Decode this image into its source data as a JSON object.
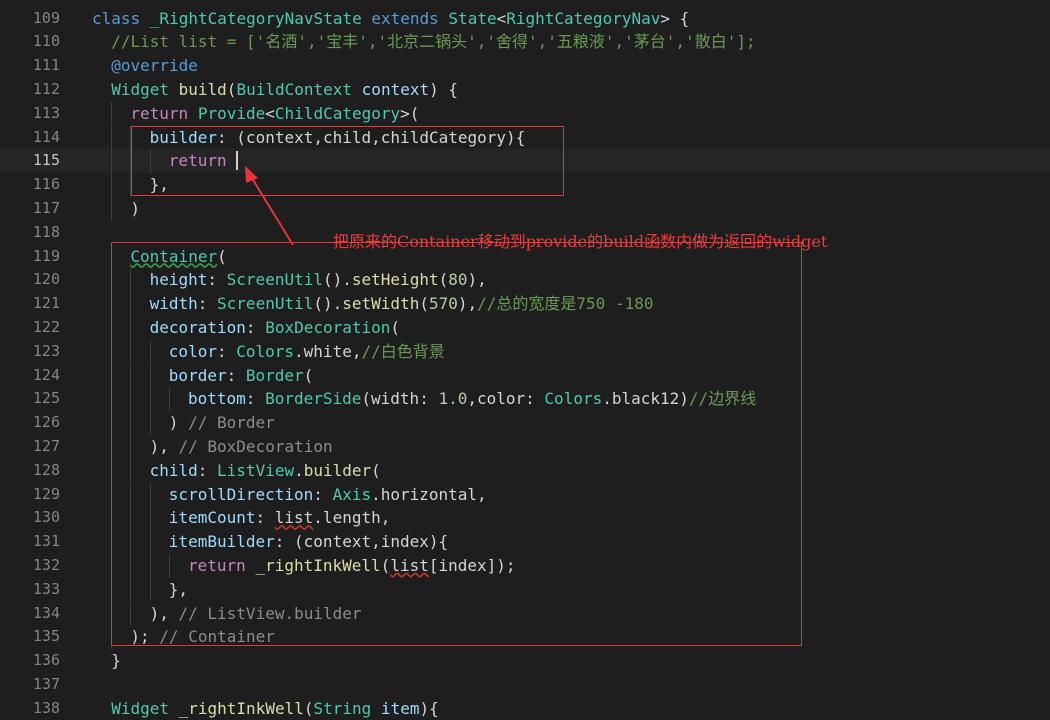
{
  "editor": {
    "lines": [
      {
        "n": "109",
        "indent": 0,
        "tokens": [
          [
            "kw",
            "class "
          ],
          [
            "cls",
            "_RightCategoryNavState "
          ],
          [
            "kw",
            "extends "
          ],
          [
            "cls",
            "State"
          ],
          [
            "pl",
            "<"
          ],
          [
            "cls",
            "RightCategoryNav"
          ],
          [
            "pl",
            "> {"
          ]
        ]
      },
      {
        "n": "110",
        "indent": 1,
        "tokens": [
          [
            "cmt",
            "//List list = ['名酒','宝丰','北京二锅头','舍得','五粮液','茅台','散白'];"
          ]
        ]
      },
      {
        "n": "111",
        "indent": 1,
        "tokens": [
          [
            "kw",
            "@override"
          ]
        ]
      },
      {
        "n": "112",
        "indent": 1,
        "tokens": [
          [
            "cls",
            "Widget "
          ],
          [
            "fn",
            "build"
          ],
          [
            "pl",
            "("
          ],
          [
            "cls",
            "BuildContext "
          ],
          [
            "var",
            "context"
          ],
          [
            "pl",
            ") {"
          ]
        ]
      },
      {
        "n": "113",
        "indent": 2,
        "tokens": [
          [
            "ctl",
            "return "
          ],
          [
            "cls",
            "Provide"
          ],
          [
            "pl",
            "<"
          ],
          [
            "cls",
            "ChildCategory"
          ],
          [
            "pl",
            ">("
          ]
        ]
      },
      {
        "n": "114",
        "indent": 3,
        "tokens": [
          [
            "var",
            "builder"
          ],
          [
            "pl",
            ": (context,child,childCategory){"
          ]
        ]
      },
      {
        "n": "115",
        "indent": 4,
        "current": true,
        "tokens": [
          [
            "ctl",
            "return "
          ]
        ]
      },
      {
        "n": "116",
        "indent": 3,
        "tokens": [
          [
            "pl",
            "},"
          ]
        ]
      },
      {
        "n": "117",
        "indent": 2,
        "tokens": [
          [
            "pl",
            ")"
          ]
        ]
      },
      {
        "n": "118",
        "indent": 0,
        "tokens": []
      },
      {
        "n": "119",
        "indent": 2,
        "tokens": [
          [
            "cls_sqg",
            "Container"
          ],
          [
            "pl",
            "("
          ]
        ]
      },
      {
        "n": "120",
        "indent": 3,
        "tokens": [
          [
            "var",
            "height"
          ],
          [
            "pl",
            ": "
          ],
          [
            "cls",
            "ScreenUtil"
          ],
          [
            "pl",
            "()."
          ],
          [
            "fn",
            "setHeight"
          ],
          [
            "pl",
            "("
          ],
          [
            "num",
            "80"
          ],
          [
            "pl",
            "),"
          ]
        ]
      },
      {
        "n": "121",
        "indent": 3,
        "tokens": [
          [
            "var",
            "width"
          ],
          [
            "pl",
            ": "
          ],
          [
            "cls",
            "ScreenUtil"
          ],
          [
            "pl",
            "()."
          ],
          [
            "fn",
            "setWidth"
          ],
          [
            "pl",
            "("
          ],
          [
            "num",
            "570"
          ],
          [
            "pl",
            "),"
          ],
          [
            "cmt",
            "//总的宽度是750 -180"
          ]
        ]
      },
      {
        "n": "122",
        "indent": 3,
        "tokens": [
          [
            "var",
            "decoration"
          ],
          [
            "pl",
            ": "
          ],
          [
            "cls",
            "BoxDecoration"
          ],
          [
            "pl",
            "("
          ]
        ]
      },
      {
        "n": "123",
        "indent": 4,
        "tokens": [
          [
            "var",
            "color"
          ],
          [
            "pl",
            ": "
          ],
          [
            "cls",
            "Colors"
          ],
          [
            "pl",
            ".white,"
          ],
          [
            "cmt",
            "//白色背景"
          ]
        ]
      },
      {
        "n": "124",
        "indent": 4,
        "tokens": [
          [
            "var",
            "border"
          ],
          [
            "pl",
            ": "
          ],
          [
            "cls",
            "Border"
          ],
          [
            "pl",
            "("
          ]
        ]
      },
      {
        "n": "125",
        "indent": 5,
        "tokens": [
          [
            "var",
            "bottom"
          ],
          [
            "pl",
            ": "
          ],
          [
            "cls",
            "BorderSide"
          ],
          [
            "pl",
            "(width: "
          ],
          [
            "num",
            "1.0"
          ],
          [
            "pl",
            ",color: "
          ],
          [
            "cls",
            "Colors"
          ],
          [
            "pl",
            ".black12)"
          ],
          [
            "cmt",
            "//边界线"
          ]
        ]
      },
      {
        "n": "126",
        "indent": 4,
        "tokens": [
          [
            "pl",
            ") "
          ],
          [
            "hint",
            "// Border"
          ]
        ]
      },
      {
        "n": "127",
        "indent": 3,
        "tokens": [
          [
            "pl",
            "), "
          ],
          [
            "hint",
            "// BoxDecoration"
          ]
        ]
      },
      {
        "n": "128",
        "indent": 3,
        "tokens": [
          [
            "var",
            "child"
          ],
          [
            "pl",
            ": "
          ],
          [
            "cls",
            "ListView"
          ],
          [
            "pl",
            "."
          ],
          [
            "fn",
            "builder"
          ],
          [
            "pl",
            "("
          ]
        ]
      },
      {
        "n": "129",
        "indent": 4,
        "tokens": [
          [
            "var",
            "scrollDirection"
          ],
          [
            "pl",
            ": "
          ],
          [
            "cls",
            "Axis"
          ],
          [
            "pl",
            ".horizontal,"
          ]
        ]
      },
      {
        "n": "130",
        "indent": 4,
        "tokens": [
          [
            "var",
            "itemCount"
          ],
          [
            "pl",
            ": "
          ],
          [
            "pl_sq",
            "list"
          ],
          [
            "pl",
            ".length,"
          ]
        ]
      },
      {
        "n": "131",
        "indent": 4,
        "tokens": [
          [
            "var",
            "itemBuilder"
          ],
          [
            "pl",
            ": (context,index){"
          ]
        ]
      },
      {
        "n": "132",
        "indent": 5,
        "tokens": [
          [
            "ctl",
            "return "
          ],
          [
            "fn",
            "_rightInkWell"
          ],
          [
            "pl",
            "("
          ],
          [
            "pl_sq",
            "list"
          ],
          [
            "pl",
            "[index]);"
          ]
        ]
      },
      {
        "n": "133",
        "indent": 4,
        "tokens": [
          [
            "pl",
            "},"
          ]
        ]
      },
      {
        "n": "134",
        "indent": 3,
        "tokens": [
          [
            "pl",
            "), "
          ],
          [
            "hint",
            "// ListView.builder"
          ]
        ]
      },
      {
        "n": "135",
        "indent": 2,
        "tokens": [
          [
            "pl",
            "); "
          ],
          [
            "hint",
            "// Container"
          ]
        ]
      },
      {
        "n": "136",
        "indent": 1,
        "tokens": [
          [
            "pl",
            "}"
          ]
        ]
      },
      {
        "n": "137",
        "indent": 0,
        "tokens": []
      },
      {
        "n": "138",
        "indent": 1,
        "tokens": [
          [
            "cls",
            "Widget "
          ],
          [
            "fn",
            "_rightInkWell"
          ],
          [
            "pl",
            "("
          ],
          [
            "cls",
            "String "
          ],
          [
            "var",
            "item"
          ],
          [
            "pl",
            "){"
          ]
        ]
      }
    ]
  },
  "annotation": {
    "text": "把原来的Container移动到provide的build函数内做为返回的widget",
    "color": "#ee3b3b"
  }
}
